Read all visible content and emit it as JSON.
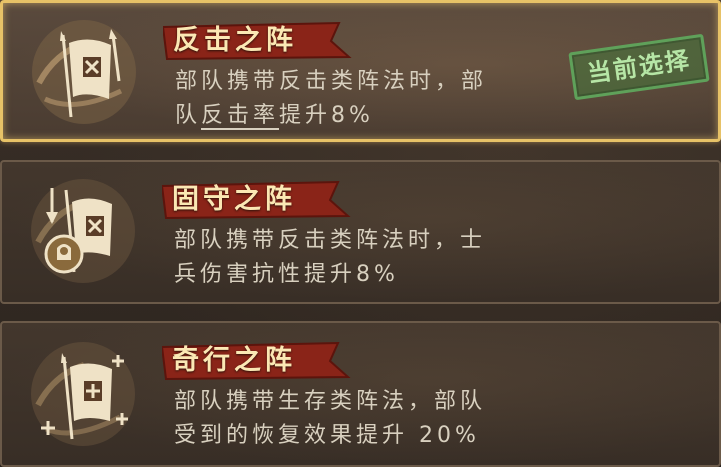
{
  "formations": [
    {
      "title": "反击之阵",
      "desc_line1": "部队携带反击类阵法时，部",
      "desc_line2_prefix": "队",
      "desc_line2_highlight": "反击率",
      "desc_line2_suffix": "提升8%",
      "icon": "counterattack-banner-icon",
      "selected": true,
      "badge": "当前选择"
    },
    {
      "title": "固守之阵",
      "desc_line1": "部队携带反击类阵法时，士",
      "desc_line2": "兵伤害抗性提升8%",
      "icon": "defense-banner-icon",
      "selected": false
    },
    {
      "title": "奇行之阵",
      "desc_line1": "部队携带生存类阵法，部队",
      "desc_line2": "受到的恢复效果提升 20%",
      "icon": "healing-banner-icon",
      "selected": false
    }
  ],
  "colors": {
    "selected_border": "#e7c267",
    "ribbon": "#8a2418",
    "title_text": "#fbe8b4",
    "desc_text": "#d8d0bf",
    "badge_green": "#5fa15a"
  }
}
